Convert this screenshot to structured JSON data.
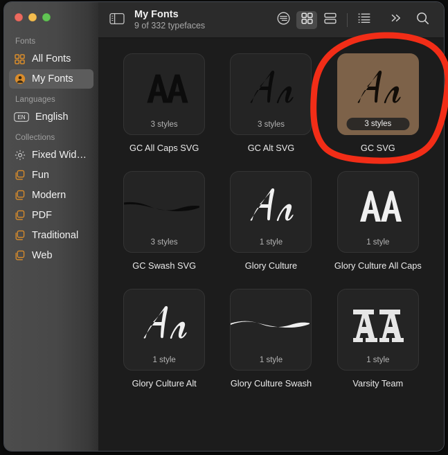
{
  "window": {
    "traffic_lights": [
      {
        "name": "close",
        "color": "#ec6a5f"
      },
      {
        "name": "minimize",
        "color": "#f4bd4f"
      },
      {
        "name": "zoom",
        "color": "#61c454"
      }
    ]
  },
  "sidebar": {
    "sections": [
      {
        "header": "Fonts",
        "items": [
          {
            "label": "All Fonts",
            "icon": "grid-squares-icon",
            "selected": false
          },
          {
            "label": "My Fonts",
            "icon": "person-circle-icon",
            "selected": true
          }
        ]
      },
      {
        "header": "Languages",
        "items": [
          {
            "label": "English",
            "icon": "en-badge-icon",
            "selected": false
          }
        ]
      },
      {
        "header": "Collections",
        "items": [
          {
            "label": "Fixed Wid…",
            "icon": "gear-icon",
            "selected": false
          },
          {
            "label": "Fun",
            "icon": "collection-folder-icon",
            "selected": false
          },
          {
            "label": "Modern",
            "icon": "collection-folder-icon",
            "selected": false
          },
          {
            "label": "PDF",
            "icon": "collection-folder-icon",
            "selected": false
          },
          {
            "label": "Traditional",
            "icon": "collection-folder-icon",
            "selected": false
          },
          {
            "label": "Web",
            "icon": "collection-folder-icon",
            "selected": false
          }
        ]
      }
    ],
    "accent_color": "#d98c2b"
  },
  "toolbar": {
    "sidebar_toggle": "sidebar-toggle-icon",
    "title": "My Fonts",
    "subtitle": "9 of 332 typefaces",
    "buttons": [
      {
        "name": "sort-filter-button",
        "icon": "circle-lines-icon",
        "active": false
      },
      {
        "name": "grid-view-button",
        "icon": "grid-view-icon",
        "active": true
      },
      {
        "name": "card-view-button",
        "icon": "stacked-rows-icon",
        "active": false
      },
      {
        "name": "list-view-button",
        "icon": "list-view-icon",
        "active": false
      },
      {
        "name": "more-button",
        "icon": "chevron-double-right-icon",
        "active": false
      },
      {
        "name": "search-button",
        "icon": "search-icon",
        "active": false
      }
    ]
  },
  "grid": {
    "tiles": [
      {
        "name": "GC All Caps SVG",
        "styles": "3 styles",
        "sample": "AA",
        "sample_style": "allcaps-dark",
        "selected": false
      },
      {
        "name": "GC Alt SVG",
        "styles": "3 styles",
        "sample": "Aa",
        "sample_style": "script-dark",
        "selected": false
      },
      {
        "name": "GC SVG",
        "styles": "3 styles",
        "sample": "Aa",
        "sample_style": "script-dark",
        "selected": true
      },
      {
        "name": "GC Swash SVG",
        "styles": "3 styles",
        "sample": "",
        "sample_style": "swash-dark",
        "selected": false
      },
      {
        "name": "Glory Culture",
        "styles": "1 style",
        "sample": "Aa",
        "sample_style": "script-light",
        "selected": false
      },
      {
        "name": "Glory Culture All Caps",
        "styles": "1 style",
        "sample": "AA",
        "sample_style": "allcaps-light",
        "selected": false
      },
      {
        "name": "Glory Culture Alt",
        "styles": "1 style",
        "sample": "Aa",
        "sample_style": "script-light",
        "selected": false
      },
      {
        "name": "Glory Culture Swash",
        "styles": "1 style",
        "sample": "",
        "sample_style": "swash-light",
        "selected": false
      },
      {
        "name": "Varsity Team",
        "styles": "1 style",
        "sample": "AA",
        "sample_style": "varsity-light",
        "selected": false
      }
    ]
  },
  "annotation": {
    "name": "red-circle-highlight",
    "color": "#f22d17",
    "target": "GC SVG"
  }
}
